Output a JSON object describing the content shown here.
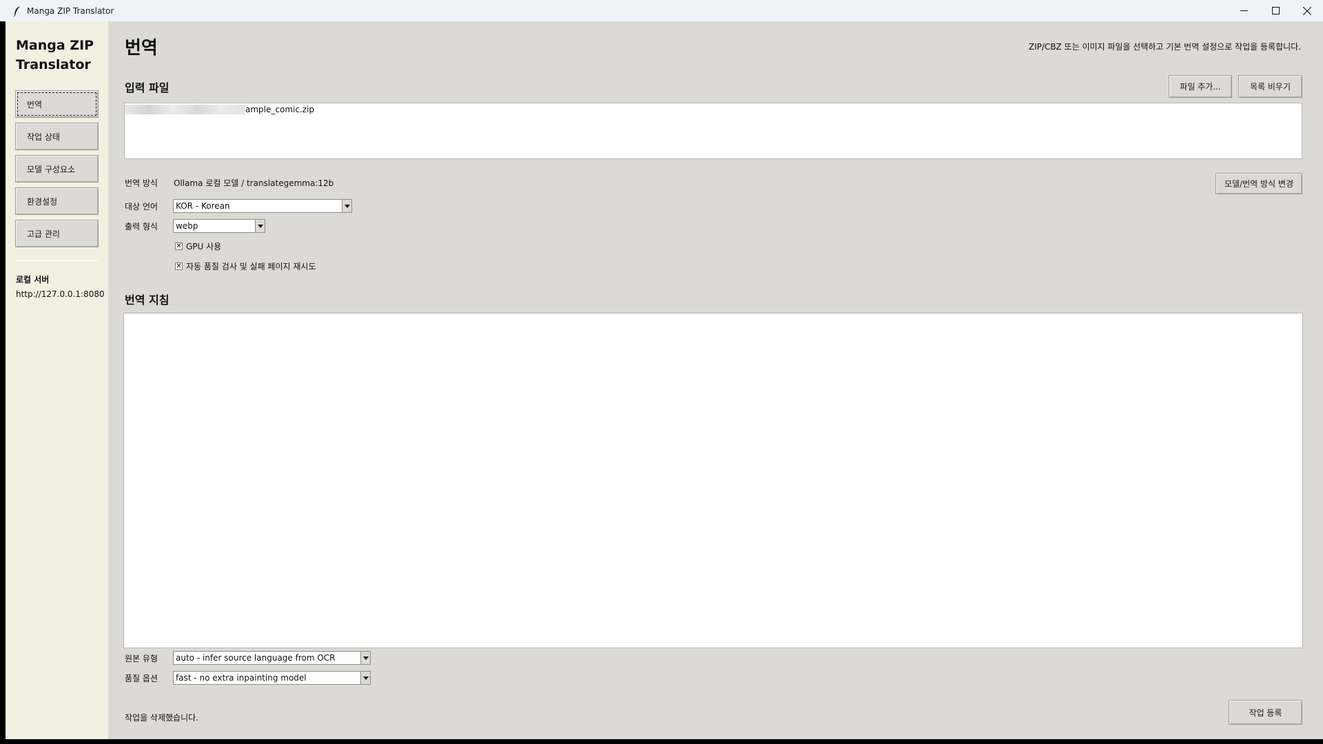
{
  "window": {
    "title": "Manga ZIP Translator",
    "app_icon": "feather-icon"
  },
  "sidebar": {
    "app_name_line1": "Manga ZIP",
    "app_name_line2": "Translator",
    "items": [
      {
        "label": "번역",
        "active": true
      },
      {
        "label": "작업 상태",
        "active": false
      },
      {
        "label": "모델 구성요소",
        "active": false
      },
      {
        "label": "환경설정",
        "active": false
      },
      {
        "label": "고급 관리",
        "active": false
      }
    ],
    "server_title": "로컬 서버",
    "server_url": "http://127.0.0.1:8080"
  },
  "main": {
    "title": "번역",
    "description": "ZIP/CBZ 또는 이미지 파일을 선택하고 기본 번역 설정으로 작업을 등록합니다.",
    "input_section": {
      "title": "입력 파일",
      "add_files_label": "파일 추가...",
      "clear_list_label": "목록 비우기",
      "files": [
        "ample_comic.zip"
      ]
    },
    "settings": {
      "method_label": "번역 방식",
      "method_value": "Ollama 로컬 모델 / translategemma:12b",
      "change_model_label": "모델/번역 방식 변경",
      "target_lang_label": "대상 언어",
      "target_lang_value": "KOR - Korean",
      "output_format_label": "출력 형식",
      "output_format_value": "webp",
      "gpu_label": "GPU 사용",
      "gpu_checked": true,
      "auto_qc_label": "자동 품질 검사 및 실패 페이지 재시도",
      "auto_qc_checked": true
    },
    "guidelines": {
      "title": "번역 지침",
      "text": ""
    },
    "bottom": {
      "source_type_label": "원본 유형",
      "source_type_value": "auto - infer source language from OCR",
      "quality_label": "품질 옵션",
      "quality_value": "fast - no extra inpainting model",
      "status_text": "작업을 삭제했습니다.",
      "submit_label": "작업 등록"
    }
  }
}
